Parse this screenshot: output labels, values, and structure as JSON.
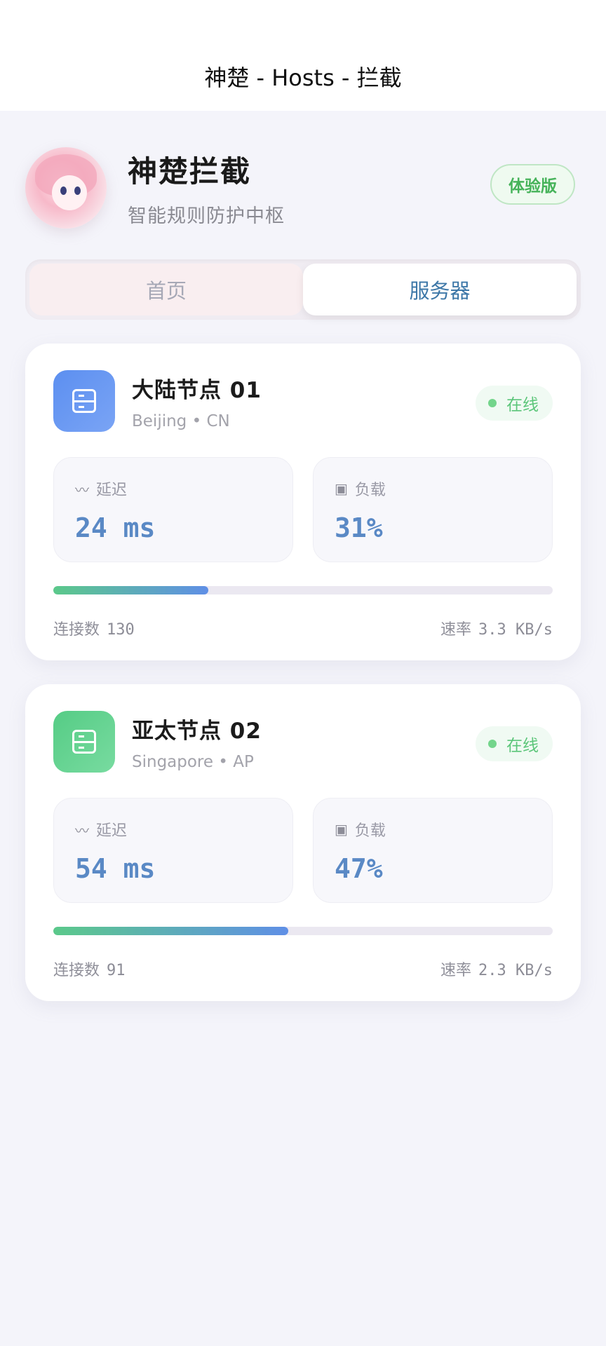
{
  "window": {
    "title": "神楚 - Hosts - 拦截"
  },
  "profile": {
    "name": "神楚拦截",
    "subtitle": "智能规则防护中枢",
    "badge": "体验版"
  },
  "tabs": [
    {
      "label": "首页",
      "active": false
    },
    {
      "label": "服务器",
      "active": true
    }
  ],
  "servers": [
    {
      "name": "大陆节点 01",
      "location": "Beijing • CN",
      "status": "在线",
      "icon": "server-icon",
      "icon_color": "#5c8ff0",
      "latency_label": "延迟",
      "latency": "24 ms",
      "load_label": "负载",
      "load": "31%",
      "load_fraction": 0.31,
      "connections_label": "连接数",
      "connections": "130",
      "rate_label": "速率",
      "rate": "3.3 KB/s"
    },
    {
      "name": "亚太节点 02",
      "location": "Singapore • AP",
      "status": "在线",
      "icon": "server-icon",
      "icon_color": "#55cc85",
      "latency_label": "延迟",
      "latency": "54 ms",
      "load_label": "负载",
      "load": "47%",
      "load_fraction": 0.47,
      "connections_label": "连接数",
      "connections": "91",
      "rate_label": "速率",
      "rate": "2.3 KB/s"
    }
  ],
  "colors": {
    "accent": "#3e78a8",
    "online": "#5cc67a",
    "trial_badge": "#46b35a"
  }
}
